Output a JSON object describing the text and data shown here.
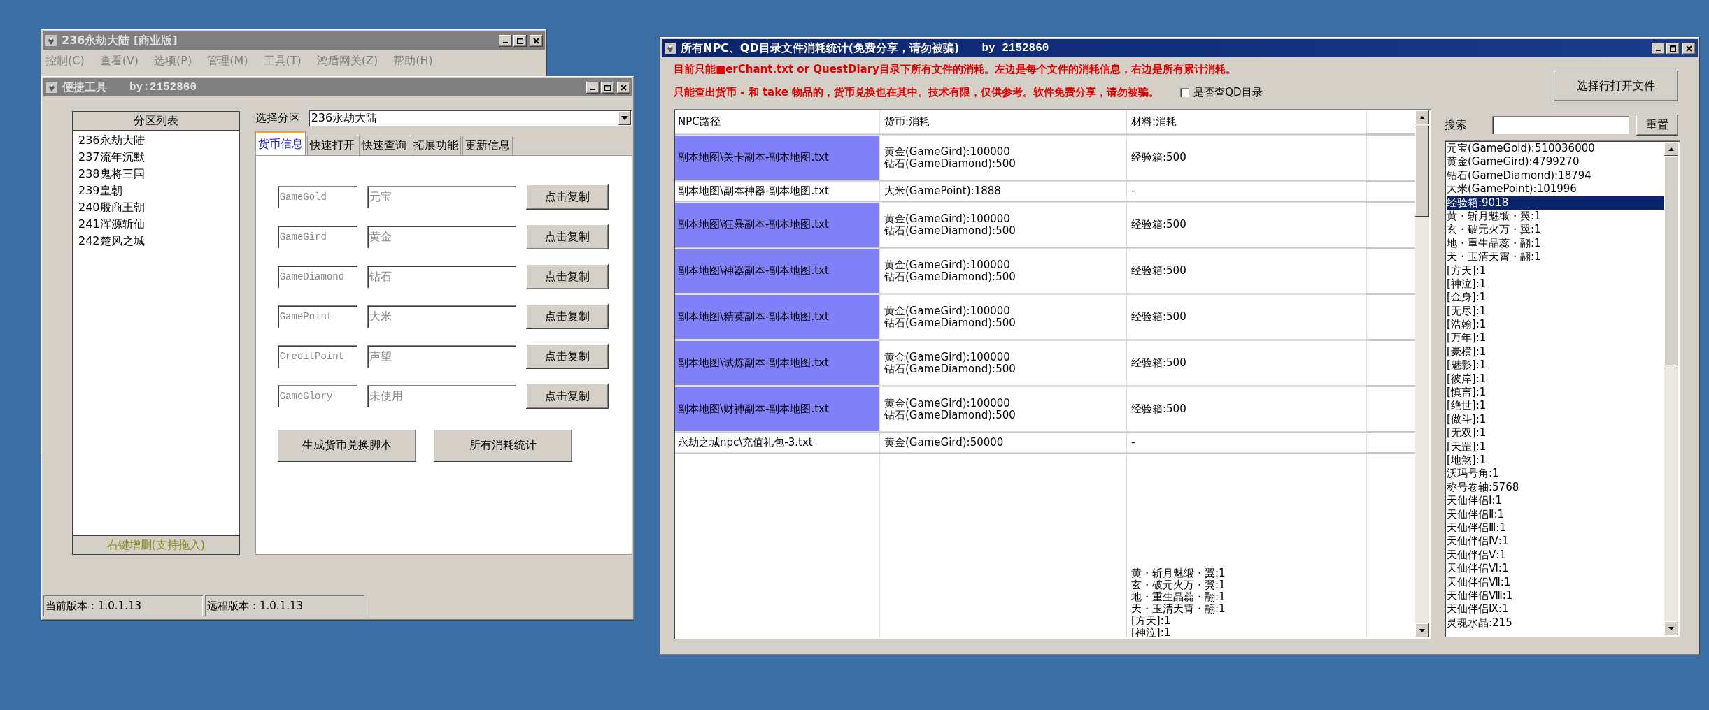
{
  "back_window": {
    "title": "236永劫大陆 [商业版]",
    "menu": [
      "控制(C)",
      "查看(V)",
      "选项(P)",
      "管理(M)",
      "工具(T)",
      "鸿盾网关(Z)",
      "帮助(H)"
    ]
  },
  "tool_window": {
    "title": "便捷工具",
    "author": "by:2152860",
    "partition_list": {
      "header": "分区列表",
      "items": [
        "236永劫大陆",
        "237流年沉默",
        "238鬼将三国",
        "239皇朝",
        "240殷商王朝",
        "241浑源斩仙",
        "242楚风之城"
      ],
      "footer": "右键增删(支持拖入)"
    },
    "partition_select": {
      "label": "选择分区",
      "value": "236永劫大陆"
    },
    "tabs": [
      {
        "label": "货币信息",
        "selected": true
      },
      {
        "label": "快速打开",
        "selected": false
      },
      {
        "label": "快速查询",
        "selected": false
      },
      {
        "label": "拓展功能",
        "selected": false
      },
      {
        "label": "更新信息",
        "selected": false
      }
    ],
    "currency_fields": [
      {
        "key": "GameGold",
        "name": "元宝",
        "button": "点击复制"
      },
      {
        "key": "GameGird",
        "name": "黄金",
        "button": "点击复制"
      },
      {
        "key": "GameDiamond",
        "name": "钻石",
        "button": "点击复制"
      },
      {
        "key": "GamePoint",
        "name": "大米",
        "button": "点击复制"
      },
      {
        "key": "CreditPoint",
        "name": "声望",
        "button": "点击复制"
      },
      {
        "key": "GameGlory",
        "name": "未使用",
        "button": "点击复制"
      }
    ],
    "actions": [
      "生成货币兑换脚本",
      "所有消耗统计"
    ],
    "status_bar": [
      "当前版本：1.0.1.13",
      "远程版本：1.0.1.13"
    ]
  },
  "stats_window": {
    "title": "所有NPC、QD目录文件消耗统计(免费分享，请勿被骗)",
    "author": "by 2152860",
    "notes": [
      "目前只能■erChant.txt or QuestDiary目录下所有文件的消耗。左边是每个文件的消耗信息，右边是所有累计消耗。",
      "只能查出货币 - 和 take 物品的，货币兑换也在其中。技术有限，仅供参考。软件免费分享，请勿被骗。"
    ],
    "qd_checkbox": {
      "label": "是否查QD目录",
      "checked": false
    },
    "open_button": "选择行打开文件",
    "table": {
      "columns": [
        "NPC路径",
        "货币:消耗",
        "材料:消耗"
      ],
      "rows": [
        {
          "path": "副本地图\\关卡副本-副本地图.txt",
          "currency": [
            "黄金(GameGird):100000",
            "钻石(GameDiamond):500"
          ],
          "materials": [
            "经验箱:500"
          ],
          "selected": true
        },
        {
          "path": "副本地图\\副本神器-副本地图.txt",
          "currency": [
            "大米(GamePoint):1888"
          ],
          "materials": [
            "-"
          ],
          "selected": false
        },
        {
          "path": "副本地图\\狂暴副本-副本地图.txt",
          "currency": [
            "黄金(GameGird):100000",
            "钻石(GameDiamond):500"
          ],
          "materials": [
            "经验箱:500"
          ],
          "selected": true
        },
        {
          "path": "副本地图\\神器副本-副本地图.txt",
          "currency": [
            "黄金(GameGird):100000",
            "钻石(GameDiamond):500"
          ],
          "materials": [
            "经验箱:500"
          ],
          "selected": true
        },
        {
          "path": "副本地图\\精英副本-副本地图.txt",
          "currency": [
            "黄金(GameGird):100000",
            "钻石(GameDiamond):500"
          ],
          "materials": [
            "经验箱:500"
          ],
          "selected": true
        },
        {
          "path": "副本地图\\试炼副本-副本地图.txt",
          "currency": [
            "黄金(GameGird):100000",
            "钻石(GameDiamond):500"
          ],
          "materials": [
            "经验箱:500"
          ],
          "selected": true
        },
        {
          "path": "副本地图\\财神副本-副本地图.txt",
          "currency": [
            "黄金(GameGird):100000",
            "钻石(GameDiamond):500"
          ],
          "materials": [
            "经验箱:500"
          ],
          "selected": true
        },
        {
          "path": "永劫之城npc\\充值礼包-3.txt",
          "currency": [
            "黄金(GameGird):50000"
          ],
          "materials": [
            "-"
          ],
          "selected": false
        },
        {
          "materials": [
            "黄・斩月魅缎・翼:1",
            "玄・破元火万・翼:1",
            "地・重生晶蕊・翮:1",
            "天・玉清天霄・翮:1",
            "[方天]:1",
            "[神泣]:1"
          ]
        }
      ]
    },
    "search": {
      "label": "搜索",
      "button": "重置"
    },
    "totals": [
      {
        "text": "元宝(GameGold):510036000",
        "selected": false
      },
      {
        "text": "黄金(GameGird):4799270",
        "selected": false
      },
      {
        "text": "钻石(GameDiamond):18794",
        "selected": false
      },
      {
        "text": "大米(GamePoint):101996",
        "selected": false
      },
      {
        "text": "经验箱:9018",
        "selected": true
      },
      {
        "text": "黄・斩月魅缎・翼:1",
        "selected": false
      },
      {
        "text": "玄・破元火万・翼:1",
        "selected": false
      },
      {
        "text": "地・重生晶蕊・翮:1",
        "selected": false
      },
      {
        "text": "天・玉清天霄・翮:1",
        "selected": false
      },
      {
        "text": "[方天]:1",
        "selected": false
      },
      {
        "text": "[神泣]:1",
        "selected": false
      },
      {
        "text": "[金身]:1",
        "selected": false
      },
      {
        "text": "[无尽]:1",
        "selected": false
      },
      {
        "text": "[浩翰]:1",
        "selected": false
      },
      {
        "text": "[万年]:1",
        "selected": false
      },
      {
        "text": "[豪横]:1",
        "selected": false
      },
      {
        "text": "[魅影]:1",
        "selected": false
      },
      {
        "text": "[彼岸]:1",
        "selected": false
      },
      {
        "text": "[慎言]:1",
        "selected": false
      },
      {
        "text": "[绝世]:1",
        "selected": false
      },
      {
        "text": "[傲斗]:1",
        "selected": false
      },
      {
        "text": "[无双]:1",
        "selected": false
      },
      {
        "text": "[天罡]:1",
        "selected": false
      },
      {
        "text": "[地煞]:1",
        "selected": false
      },
      {
        "text": "沃玛号角:1",
        "selected": false
      },
      {
        "text": "称号卷轴:5768",
        "selected": false
      },
      {
        "text": "天仙伴侣Ⅰ:1",
        "selected": false
      },
      {
        "text": "天仙伴侣Ⅱ:1",
        "selected": false
      },
      {
        "text": "天仙伴侣Ⅲ:1",
        "selected": false
      },
      {
        "text": "天仙伴侣Ⅳ:1",
        "selected": false
      },
      {
        "text": "天仙伴侣Ⅴ:1",
        "selected": false
      },
      {
        "text": "天仙伴侣Ⅵ:1",
        "selected": false
      },
      {
        "text": "天仙伴侣Ⅶ:1",
        "selected": false
      },
      {
        "text": "天仙伴侣Ⅷ:1",
        "selected": false
      },
      {
        "text": "天仙伴侣Ⅸ:1",
        "selected": false
      },
      {
        "text": "灵魂水晶:215",
        "selected": false
      }
    ]
  }
}
